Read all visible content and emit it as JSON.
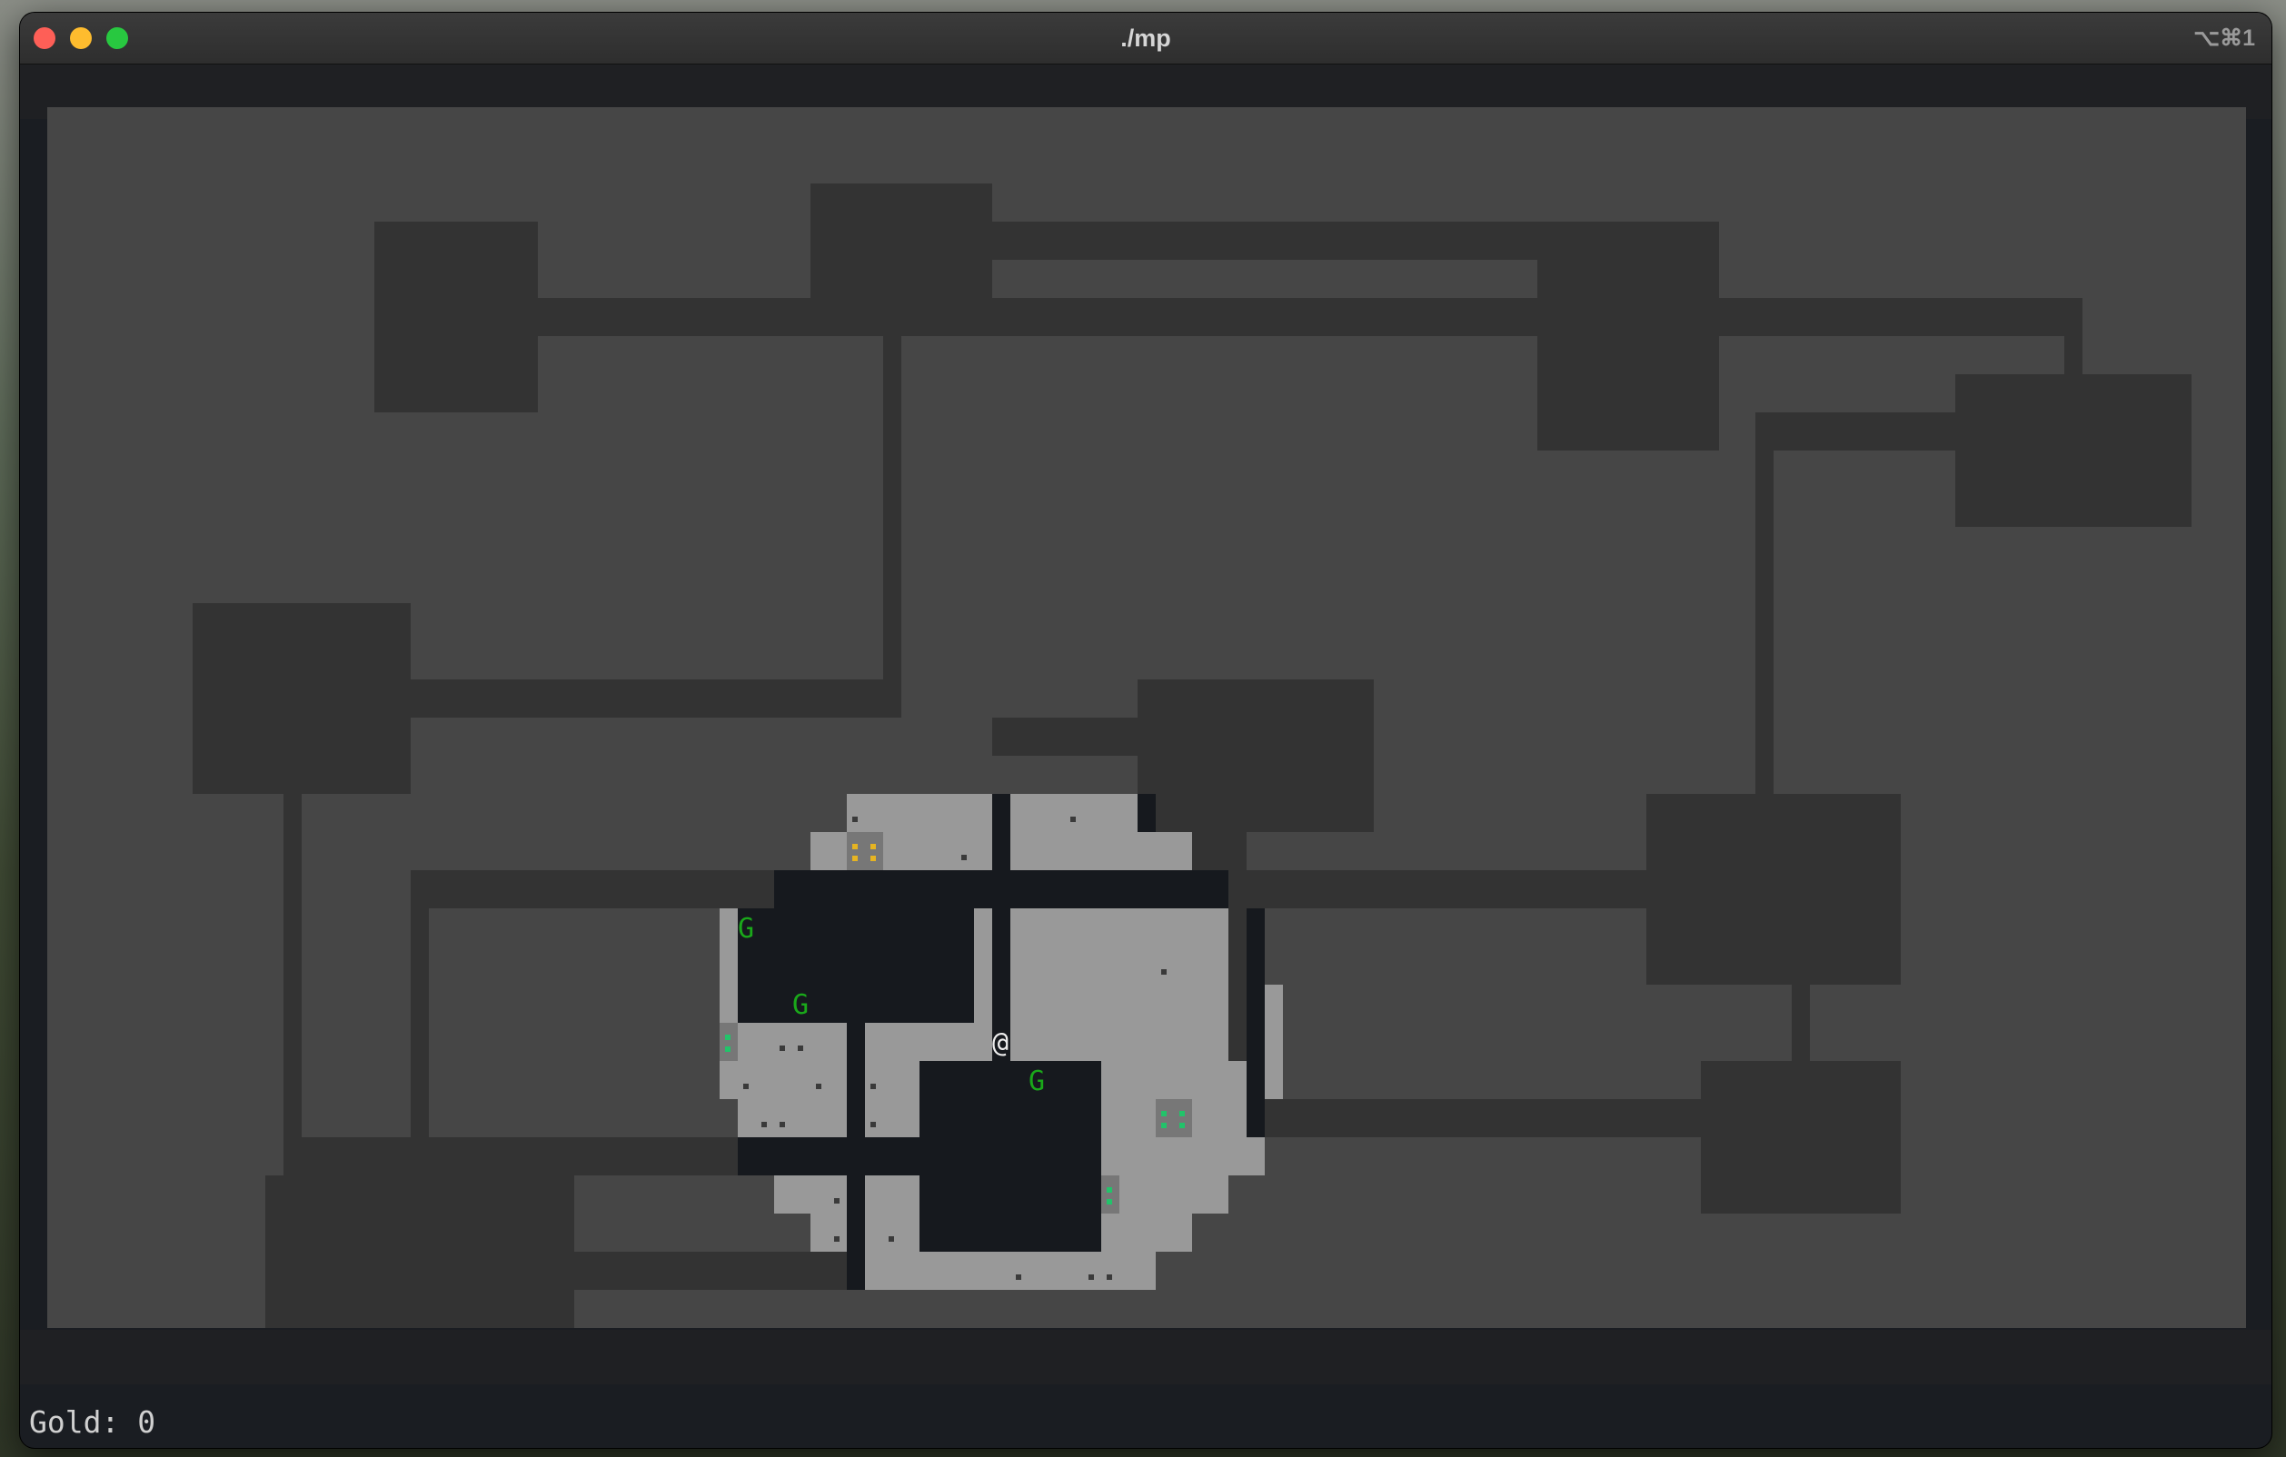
{
  "window": {
    "title": "./mp",
    "shortcut": "⌥⌘1"
  },
  "status": {
    "gold_label": "Gold: 0"
  },
  "player": {
    "glyph": "@"
  },
  "monsters": [
    {
      "glyph": "G",
      "color": "#1aa81a"
    },
    {
      "glyph": "G",
      "color": "#1aa81a"
    },
    {
      "glyph": "G",
      "color": "#1aa81a"
    }
  ],
  "items": [
    {
      "kind": "gold",
      "color": "#e6b422"
    },
    {
      "kind": "gem",
      "color": "#22c36a"
    },
    {
      "kind": "gem",
      "color": "#22c36a"
    },
    {
      "kind": "gem",
      "color": "#22c36a"
    }
  ],
  "colors": {
    "unexplored": "#464646",
    "remembered": "#333333",
    "lit_floor": "#999999",
    "dark_wall": "#16191e",
    "floor_dot": "#3a3a3a"
  }
}
